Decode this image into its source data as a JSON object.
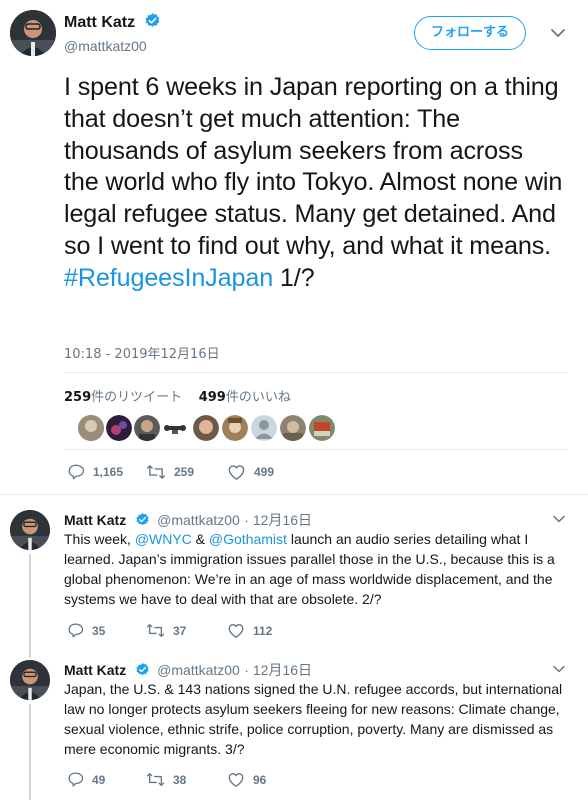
{
  "main_tweet": {
    "author_name": "Matt Katz",
    "author_handle": "@mattkatz00",
    "follow_label": "フォローする",
    "text_plain": "I spent 6 weeks in Japan reporting on a thing that doesn’t get much attention: The thousands of asylum seekers from across the world who fly into Tokyo. Almost none win legal refugee status. Many get detained. And so I went to find out why, and what it means.",
    "hashtag": "#RefugeesInJapan",
    "suffix": " 1/?",
    "timestamp": "10:18 - 2019年12月16日",
    "retweets_count": "259",
    "retweets_label": "件のリツイート",
    "likes_count": "499",
    "likes_label": "件のいいね",
    "replies": "1,165",
    "retweets": "259",
    "likes": "499"
  },
  "replies": [
    {
      "author_name": "Matt Katz",
      "author_handle": "@mattkatz00",
      "date": "· 12月16日",
      "text_a": "This week, ",
      "mention_1": "@WNYC",
      "text_b": " & ",
      "mention_2": "@Gothamist",
      "text_c": " launch an audio series detailing what I learned. Japan’s immigration issues parallel those in the U.S., because this is a global phenomenon: We’re in an age of mass worldwide displacement, and the systems we have to deal with that are obsolete. 2/?",
      "replies": "35",
      "retweets": "37",
      "likes": "112"
    },
    {
      "author_name": "Matt Katz",
      "author_handle": "@mattkatz00",
      "date": "· 12月16日",
      "text": "Japan, the U.S. & 143 nations signed the U.N. refugee accords, but international law no longer protects asylum seekers fleeing for new reasons: Climate change, sexual violence, ethnic strife, police corruption, poverty. Many are dismissed as mere economic migrants. 3/?",
      "replies": "49",
      "retweets": "38",
      "likes": "96"
    }
  ],
  "colors": {
    "accent": "#1da1f2",
    "link": "#1b95e0",
    "muted": "#657786",
    "divider": "#e6ecf0"
  },
  "icons": [
    "verified-badge-icon",
    "chevron-down-icon",
    "reply-icon",
    "retweet-icon",
    "like-icon"
  ]
}
